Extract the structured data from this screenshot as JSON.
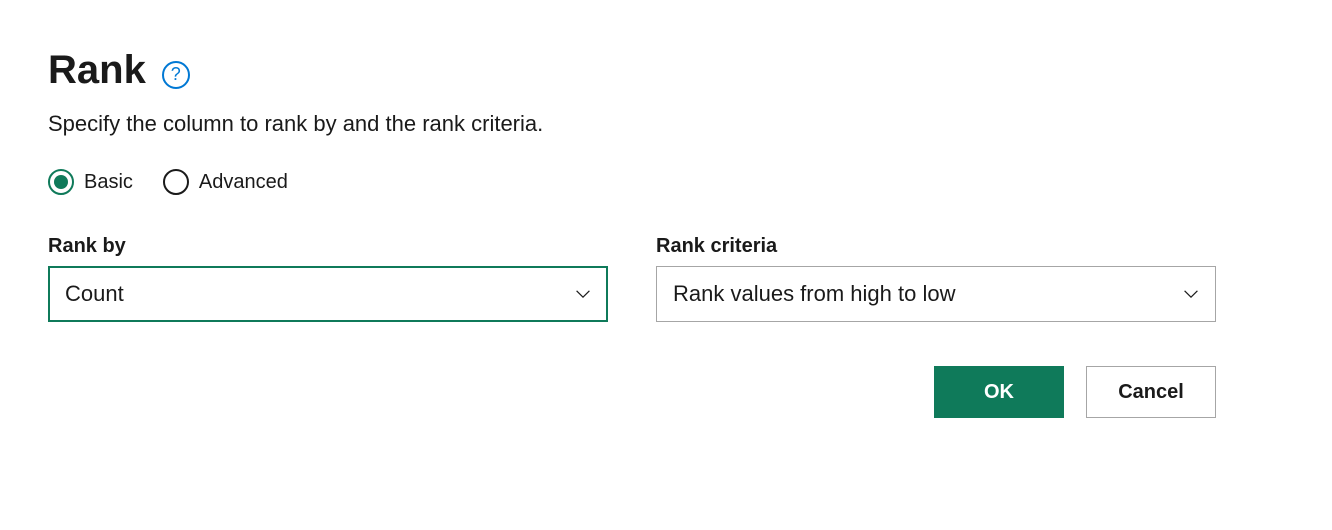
{
  "header": {
    "title": "Rank"
  },
  "description": "Specify the column to rank by and the rank criteria.",
  "mode": {
    "basic_label": "Basic",
    "advanced_label": "Advanced",
    "selected": "basic"
  },
  "rank_by": {
    "label": "Rank by",
    "value": "Count"
  },
  "rank_criteria": {
    "label": "Rank criteria",
    "value": "Rank values from high to low"
  },
  "buttons": {
    "ok": "OK",
    "cancel": "Cancel"
  },
  "colors": {
    "accent": "#0f7a5a",
    "help": "#0078d4"
  }
}
